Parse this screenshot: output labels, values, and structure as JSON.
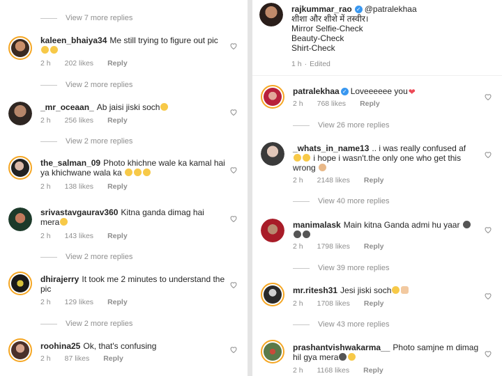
{
  "left": {
    "view_more": [
      "View 7 more replies",
      "View 2 more replies",
      "View 2 more replies",
      "View 2 more replies",
      "View 2 more replies"
    ],
    "comments": [
      {
        "user": "kaleen_bhaiya34",
        "text": "Me still trying to figure out pic",
        "time": "2 h",
        "likes": "202 likes",
        "reply": "Reply"
      },
      {
        "user": "_mr_oceaan_",
        "text": "Ab jaisi jiski soch",
        "time": "2 h",
        "likes": "256 likes",
        "reply": "Reply"
      },
      {
        "user": "the_salman_09",
        "text": "Photo khichne wale ka kamal hai ya khichwane wala ka",
        "time": "2 h",
        "likes": "138 likes",
        "reply": "Reply"
      },
      {
        "user": "srivastavgaurav360",
        "text": "Kitna ganda dimag hai mera",
        "time": "2 h",
        "likes": "143 likes",
        "reply": "Reply"
      },
      {
        "user": "dhirajerry",
        "text": "It took me 2 minutes to understand the pic",
        "time": "2 h",
        "likes": "129 likes",
        "reply": "Reply"
      },
      {
        "user": "roohina25",
        "text": "Ok, that's confusing",
        "time": "2 h",
        "likes": "87 likes",
        "reply": "Reply"
      }
    ]
  },
  "right": {
    "caption": {
      "user": "rajkummar_rao",
      "mention": "@patralekhaa",
      "lines": [
        "शीशा और शीशे में तस्वीर।",
        "Mirror Selfie-Check",
        "Beauty-Check",
        "Shirt-Check"
      ],
      "time": "1 h",
      "edited": "Edited"
    },
    "view_more": [
      "View 26 more replies",
      "View 40 more replies",
      "View 39 more replies",
      "View 43 more replies"
    ],
    "comments": [
      {
        "user": "patralekhaa",
        "text": "Loveeeeee you",
        "time": "2 h",
        "likes": "768 likes",
        "reply": "Reply"
      },
      {
        "user": "_whats_in_name13",
        "text": ".. i was really confused af",
        "text2": "i hope i wasn't.the only one who get this wrong",
        "time": "2 h",
        "likes": "2148 likes",
        "reply": "Reply"
      },
      {
        "user": "manimalask",
        "text": "Main kitna Ganda admi hu yaar",
        "time": "2 h",
        "likes": "1798 likes",
        "reply": "Reply"
      },
      {
        "user": "mr.ritesh31",
        "text": "Jesi jiski soch",
        "time": "2 h",
        "likes": "1708 likes",
        "reply": "Reply"
      },
      {
        "user": "prashantvishwakarma__",
        "text": "Photo samjne m dimag hil gya mera",
        "time": "2 h",
        "likes": "1168 likes",
        "reply": "Reply"
      }
    ]
  },
  "colors": {
    "accent_blue": "#3897f0",
    "heart_red": "#ed4956",
    "meta_grey": "#8e8e8e"
  }
}
